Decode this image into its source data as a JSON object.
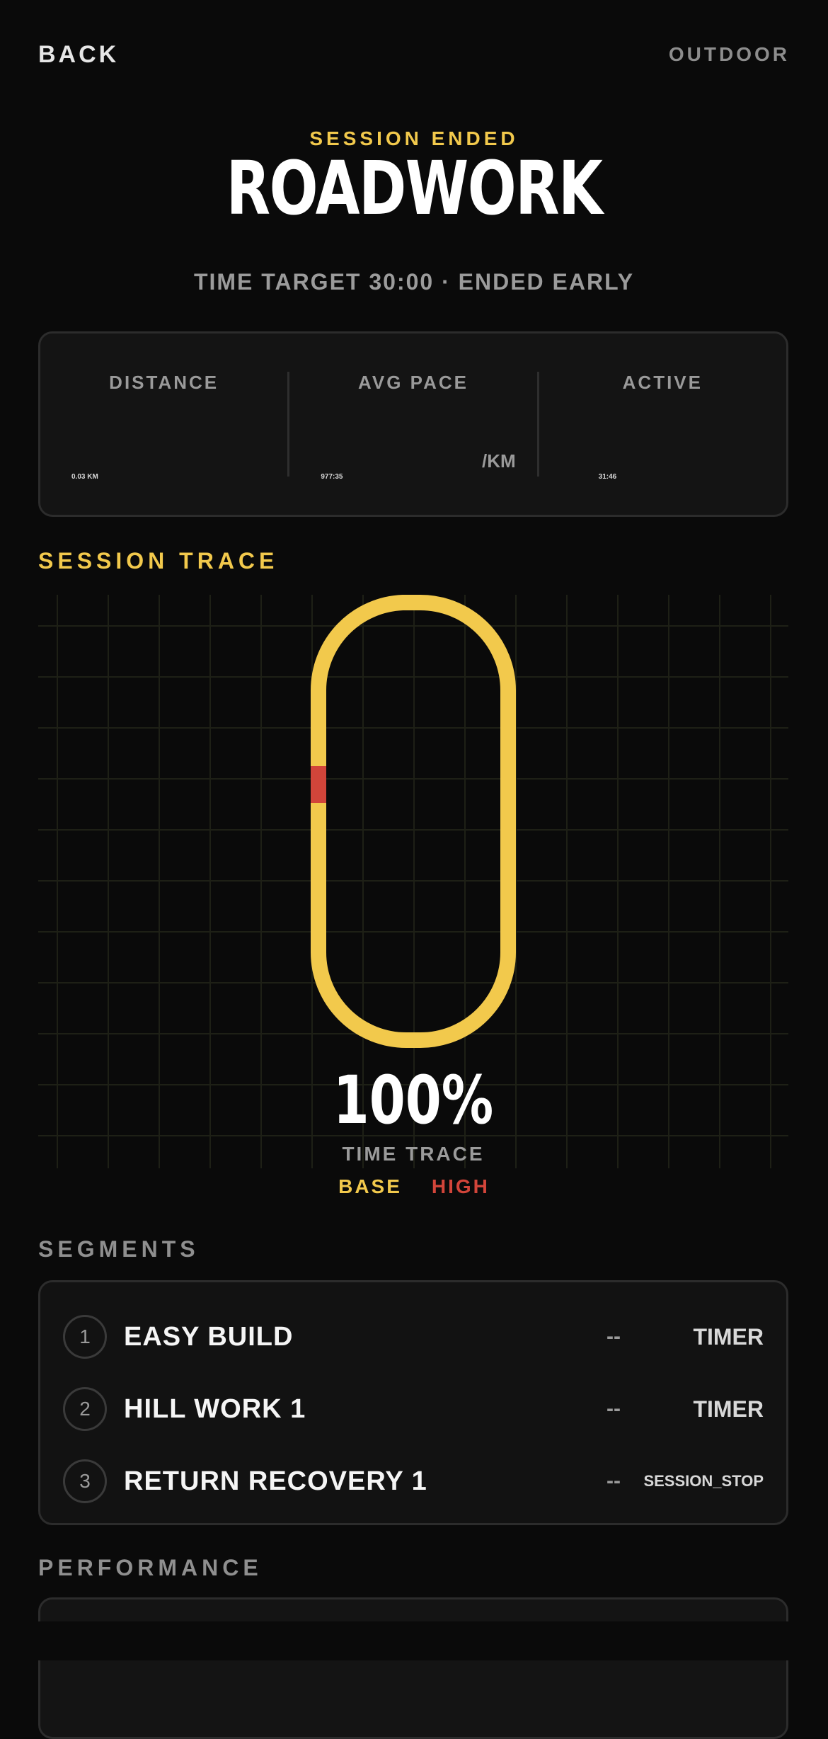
{
  "nav": {
    "back_label": "BACK",
    "mode_label": "OUTDOOR"
  },
  "header": {
    "eyebrow": "SESSION ENDED",
    "title": "ROADWORK",
    "subtitle": "TIME TARGET 30:00 · ENDED EARLY"
  },
  "stats": [
    {
      "label": "DISTANCE",
      "value": "0.03 KM",
      "unit": ""
    },
    {
      "label": "AVG PACE",
      "value": "977:35",
      "unit": "/KM"
    },
    {
      "label": "ACTIVE",
      "value": "31:46",
      "unit": ""
    }
  ],
  "trace": {
    "heading": "SESSION TRACE",
    "percent": "100%",
    "label": "TIME TRACE",
    "progress_fraction": 1.0,
    "legend": {
      "base": "BASE",
      "high": "HIGH"
    },
    "colors": {
      "base": "#f2c94c",
      "high": "#d2453a",
      "grid": "#1e2016"
    }
  },
  "segments": {
    "heading": "SEGMENTS",
    "items": [
      {
        "num": "1",
        "name": "EASY BUILD",
        "metric": "--",
        "type": "TIMER"
      },
      {
        "num": "2",
        "name": "HILL WORK 1",
        "metric": "--",
        "type": "TIMER"
      },
      {
        "num": "3",
        "name": "RETURN RECOVERY 1",
        "metric": "--",
        "type": "SESSION_STOP"
      }
    ]
  },
  "performance": {
    "heading": "PERFORMANCE"
  },
  "colors": {
    "background": "#0a0a0a",
    "accent": "#f2c94c",
    "alert": "#d2453a"
  }
}
